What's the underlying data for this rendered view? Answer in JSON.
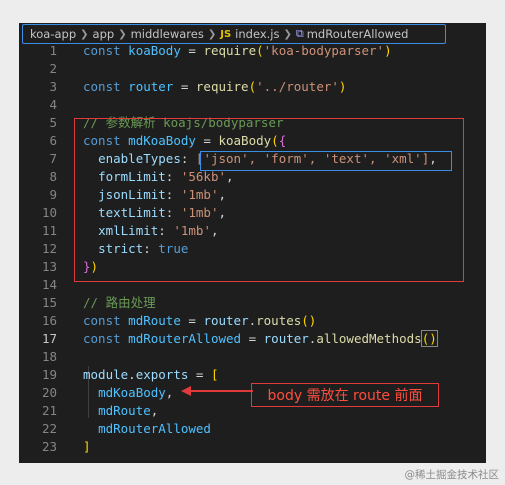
{
  "breadcrumb": {
    "items": [
      "koa-app",
      "app",
      "middlewares"
    ],
    "file_icon": "JS",
    "file": "index.js",
    "symbol": "mdRouterAllowed"
  },
  "code": {
    "line_numbers": [
      "1",
      "2",
      "3",
      "4",
      "5",
      "6",
      "7",
      "8",
      "9",
      "10",
      "11",
      "12",
      "13",
      "14",
      "15",
      "16",
      "17",
      "18",
      "19",
      "20",
      "21",
      "22",
      "23"
    ],
    "current_line": "17"
  },
  "annotation": {
    "text": "body 需放在 route 前面"
  },
  "watermark": "@稀土掘金技术社区"
}
